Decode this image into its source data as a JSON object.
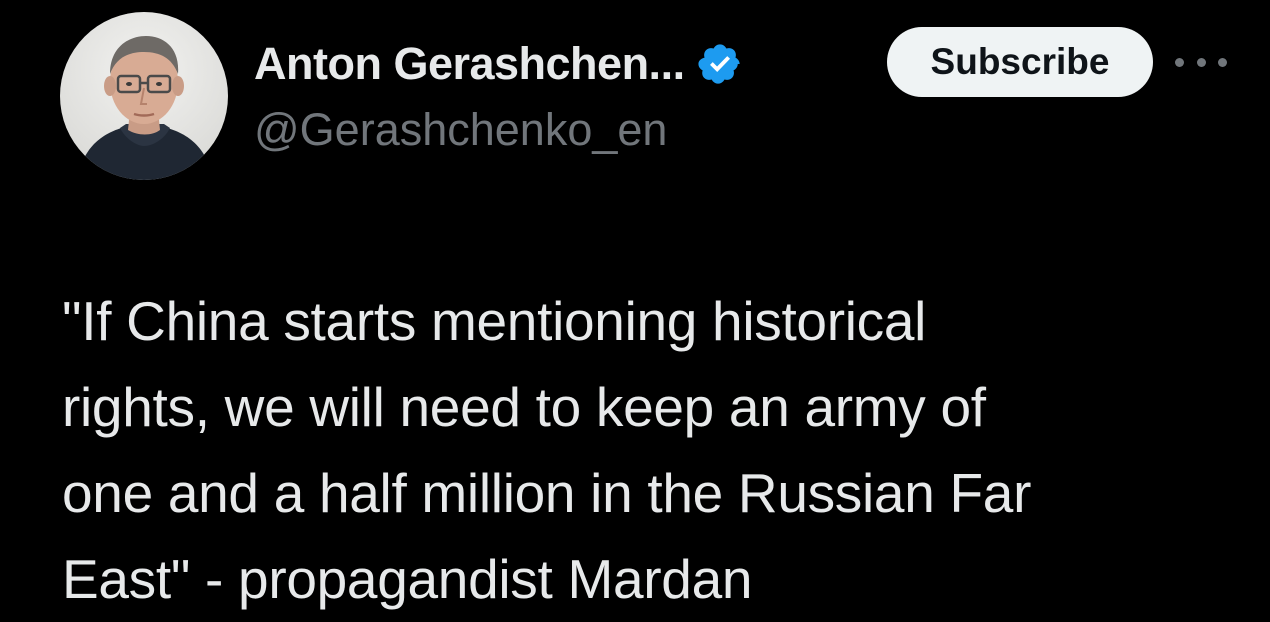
{
  "author": {
    "display_name": "Anton Gerashchen...",
    "handle": "@Gerashchenko_en",
    "avatar_icon": "person-portrait-avatar",
    "verified_icon": "verified-badge-icon",
    "verified_color": "#1d9bf0"
  },
  "actions": {
    "subscribe_label": "Subscribe",
    "more_icon": "more-options-icon"
  },
  "tweet": {
    "text_lines": [
      "\"If China starts mentioning historical",
      "rights, we will need to keep an army of",
      "one and a half million in the Russian Far",
      "East\" - propagandist Mardan"
    ]
  },
  "colors": {
    "background": "#000000",
    "primary_text": "#e7e9ea",
    "secondary_text": "#71767b",
    "button_bg": "#eff3f4",
    "button_text": "#0f1419"
  }
}
